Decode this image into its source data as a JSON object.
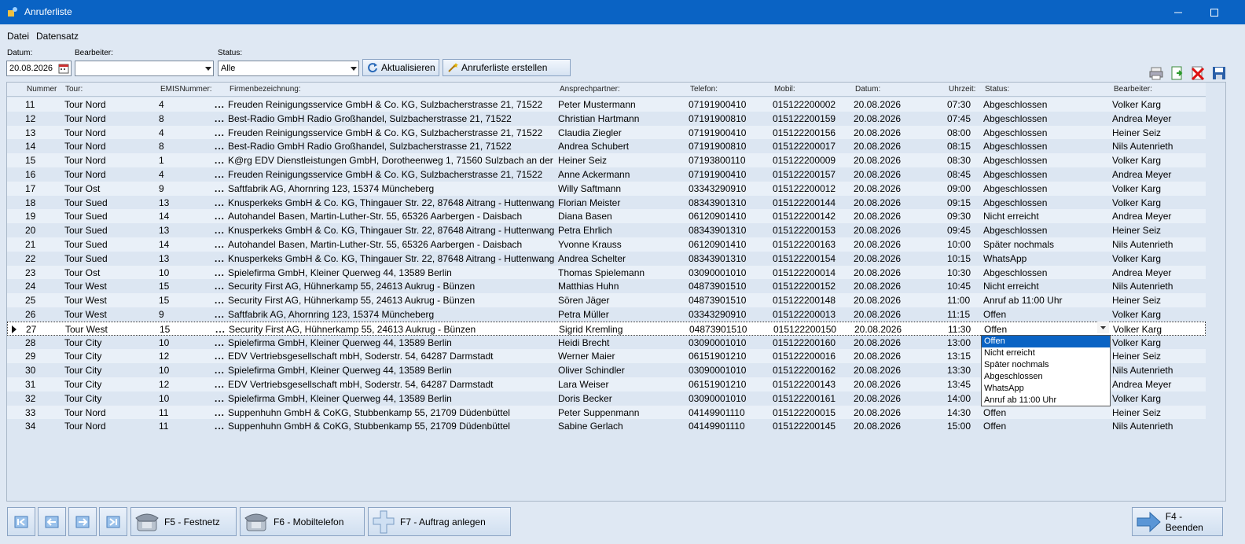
{
  "window": {
    "title": "Anruferliste"
  },
  "menu": {
    "items": [
      "Datei",
      "Datensatz"
    ]
  },
  "filters": {
    "datum_label": "Datum:",
    "datum_value": "20.08.2026",
    "bearbeiter_label": "Bearbeiter:",
    "bearbeiter_value": "",
    "status_label": "Status:",
    "status_value": "Alle"
  },
  "toolbar": {
    "refresh_label": "Aktualisieren",
    "create_label": "Anruferliste erstellen",
    "icons": [
      "printer-icon",
      "export-icon",
      "delete-icon",
      "save-icon"
    ]
  },
  "grid": {
    "columns": [
      "Nummer",
      "Tour:",
      "EMISNummer:",
      "Firmenbezeichnung:",
      "Ansprechpartner:",
      "Telefon:",
      "Mobil:",
      "Datum:",
      "Uhrzeit:",
      "Status:",
      "Bearbeiter:"
    ],
    "rows": [
      [
        "11",
        "Tour Nord",
        "4",
        "Freuden Reinigungsservice GmbH & Co. KG, Sulzbacherstrasse 21, 71522",
        "Peter Mustermann",
        "07191900410",
        "015122200002",
        "20.08.2026",
        "07:30",
        "Abgeschlossen",
        "Volker Karg"
      ],
      [
        "12",
        "Tour Nord",
        "8",
        "Best-Radio GmbH Radio Großhandel, Sulzbacherstrasse 21, 71522",
        "Christian Hartmann",
        "07191900810",
        "015122200159",
        "20.08.2026",
        "07:45",
        "Abgeschlossen",
        "Andrea Meyer"
      ],
      [
        "13",
        "Tour Nord",
        "4",
        "Freuden Reinigungsservice GmbH & Co. KG, Sulzbacherstrasse 21, 71522",
        "Claudia Ziegler",
        "07191900410",
        "015122200156",
        "20.08.2026",
        "08:00",
        "Abgeschlossen",
        "Heiner Seiz"
      ],
      [
        "14",
        "Tour Nord",
        "8",
        "Best-Radio GmbH Radio Großhandel, Sulzbacherstrasse 21, 71522",
        "Andrea Schubert",
        "07191900810",
        "015122200017",
        "20.08.2026",
        "08:15",
        "Abgeschlossen",
        "Nils Autenrieth"
      ],
      [
        "15",
        "Tour Nord",
        "1",
        "K@rg EDV Dienstleistungen GmbH, Dorotheenweg 1, 71560 Sulzbach an der",
        "Heiner Seiz",
        "07193800110",
        "015122200009",
        "20.08.2026",
        "08:30",
        "Abgeschlossen",
        "Volker Karg"
      ],
      [
        "16",
        "Tour Nord",
        "4",
        "Freuden Reinigungsservice GmbH & Co. KG, Sulzbacherstrasse 21, 71522",
        "Anne Ackermann",
        "07191900410",
        "015122200157",
        "20.08.2026",
        "08:45",
        "Abgeschlossen",
        "Andrea Meyer"
      ],
      [
        "17",
        "Tour Ost",
        "9",
        "Saftfabrik AG, Ahornring 123, 15374 Müncheberg",
        "Willy Saftmann",
        "03343290910",
        "015122200012",
        "20.08.2026",
        "09:00",
        "Abgeschlossen",
        "Volker Karg"
      ],
      [
        "18",
        "Tour Sued",
        "13",
        "Knusperkeks GmbH & Co. KG, Thingauer Str. 22, 87648 Aitrang - Huttenwang",
        "Florian Meister",
        "08343901310",
        "015122200144",
        "20.08.2026",
        "09:15",
        "Abgeschlossen",
        "Volker Karg"
      ],
      [
        "19",
        "Tour Sued",
        "14",
        "Autohandel Basen, Martin-Luther-Str. 55, 65326 Aarbergen - Daisbach",
        "Diana Basen",
        "06120901410",
        "015122200142",
        "20.08.2026",
        "09:30",
        "Nicht erreicht",
        "Andrea Meyer"
      ],
      [
        "20",
        "Tour Sued",
        "13",
        "Knusperkeks GmbH & Co. KG, Thingauer Str. 22, 87648 Aitrang - Huttenwang",
        "Petra Ehrlich",
        "08343901310",
        "015122200153",
        "20.08.2026",
        "09:45",
        "Abgeschlossen",
        "Heiner Seiz"
      ],
      [
        "21",
        "Tour Sued",
        "14",
        "Autohandel Basen, Martin-Luther-Str. 55, 65326 Aarbergen - Daisbach",
        "Yvonne Krauss",
        "06120901410",
        "015122200163",
        "20.08.2026",
        "10:00",
        "Später nochmals",
        "Nils Autenrieth"
      ],
      [
        "22",
        "Tour Sued",
        "13",
        "Knusperkeks GmbH & Co. KG, Thingauer Str. 22, 87648 Aitrang - Huttenwang",
        "Andrea Schelter",
        "08343901310",
        "015122200154",
        "20.08.2026",
        "10:15",
        "WhatsApp",
        "Volker Karg"
      ],
      [
        "23",
        "Tour Ost",
        "10",
        "Spielefirma GmbH, Kleiner Querweg 44, 13589 Berlin",
        "Thomas Spielemann",
        "03090001010",
        "015122200014",
        "20.08.2026",
        "10:30",
        "Abgeschlossen",
        "Andrea Meyer"
      ],
      [
        "24",
        "Tour West",
        "15",
        "Security First AG, Hühnerkamp 55, 24613 Aukrug - Bünzen",
        "Matthias Huhn",
        "04873901510",
        "015122200152",
        "20.08.2026",
        "10:45",
        "Nicht erreicht",
        "Nils Autenrieth"
      ],
      [
        "25",
        "Tour West",
        "15",
        "Security First AG, Hühnerkamp 55, 24613 Aukrug - Bünzen",
        "Sören Jäger",
        "04873901510",
        "015122200148",
        "20.08.2026",
        "11:00",
        "Anruf ab 11:00 Uhr",
        "Heiner Seiz"
      ],
      [
        "26",
        "Tour West",
        "9",
        "Saftfabrik AG, Ahornring 123, 15374 Müncheberg",
        "Petra Müller",
        "03343290910",
        "015122200013",
        "20.08.2026",
        "11:15",
        "Offen",
        "Volker Karg"
      ],
      [
        "27",
        "Tour West",
        "15",
        "Security First AG, Hühnerkamp 55, 24613 Aukrug - Bünzen",
        "Sigrid Kremling",
        "04873901510",
        "015122200150",
        "20.08.2026",
        "11:30",
        "Offen",
        "Volker Karg"
      ],
      [
        "28",
        "Tour City",
        "10",
        "Spielefirma GmbH, Kleiner Querweg 44, 13589 Berlin",
        "Heidi Brecht",
        "03090001010",
        "015122200160",
        "20.08.2026",
        "13:00",
        "",
        "Volker Karg"
      ],
      [
        "29",
        "Tour City",
        "12",
        "EDV Vertriebsgesellschaft mbH, Soderstr. 54, 64287 Darmstadt",
        "Werner Maier",
        "06151901210",
        "015122200016",
        "20.08.2026",
        "13:15",
        "",
        "Heiner Seiz"
      ],
      [
        "30",
        "Tour City",
        "10",
        "Spielefirma GmbH, Kleiner Querweg 44, 13589 Berlin",
        "Oliver Schindler",
        "03090001010",
        "015122200162",
        "20.08.2026",
        "13:30",
        "",
        "Nils Autenrieth"
      ],
      [
        "31",
        "Tour City",
        "12",
        "EDV Vertriebsgesellschaft mbH, Soderstr. 54, 64287 Darmstadt",
        "Lara Weiser",
        "06151901210",
        "015122200143",
        "20.08.2026",
        "13:45",
        "",
        "Andrea Meyer"
      ],
      [
        "32",
        "Tour City",
        "10",
        "Spielefirma GmbH, Kleiner Querweg 44, 13589 Berlin",
        "Doris Becker",
        "03090001010",
        "015122200161",
        "20.08.2026",
        "14:00",
        "",
        "Volker Karg"
      ],
      [
        "33",
        "Tour Nord",
        "11",
        "Suppenhuhn GmbH & CoKG, Stubbenkamp 55, 21709 Düdenbüttel",
        "Peter Suppenmann",
        "04149901110",
        "015122200015",
        "20.08.2026",
        "14:30",
        "Offen",
        "Heiner Seiz"
      ],
      [
        "34",
        "Tour Nord",
        "11",
        "Suppenhuhn GmbH & CoKG, Stubbenkamp 55, 21709 Düdenbüttel",
        "Sabine Gerlach",
        "04149901110",
        "015122200145",
        "20.08.2026",
        "15:00",
        "Offen",
        "Nils Autenrieth"
      ]
    ],
    "ellipsis": "...",
    "selected_row_index": 16
  },
  "status_dropdown": {
    "options": [
      "Offen",
      "Nicht erreicht",
      "Später nochmals",
      "Abgeschlossen",
      "WhatsApp",
      "Anruf ab 11:00 Uhr"
    ],
    "highlighted": "Offen"
  },
  "footer": {
    "nav_icons": [
      "first-record-icon",
      "previous-record-icon",
      "next-record-icon",
      "last-record-icon"
    ],
    "festnetz_label": "F5 - Festnetz",
    "mobil_label": "F6 - Mobiltelefon",
    "auftrag_label": "F7 - Auftrag anlegen",
    "beenden_label": "F4 - Beenden"
  },
  "colors": {
    "titlebar": "#0a63c4",
    "background": "#dfe8f3",
    "selection": "#0a63c4"
  }
}
